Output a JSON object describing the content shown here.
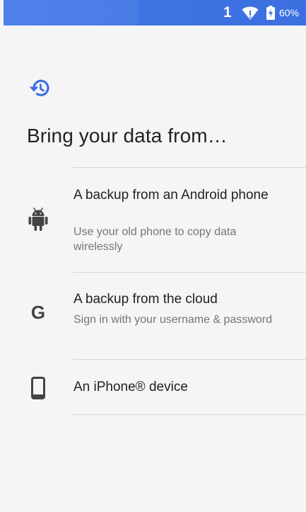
{
  "status_bar": {
    "notification_count": "1",
    "battery_percent": "60%",
    "icons": [
      "wifi-icon",
      "battery-charging-icon"
    ]
  },
  "header": {
    "icon": "history-icon",
    "title": "Bring your data from…"
  },
  "options": [
    {
      "icon": "android-icon",
      "title": "A backup from an Android phone",
      "subtitle": "Use your old phone to copy data wirelessly"
    },
    {
      "icon": "google-icon",
      "title": "A backup from the cloud",
      "subtitle": "Sign in with your username & password"
    },
    {
      "icon": "phone-icon",
      "title": "An iPhone® device"
    }
  ],
  "colors": {
    "accent": "#3b6fe0",
    "background": "#f5f5f5",
    "icon_gray": "#5f6368"
  }
}
